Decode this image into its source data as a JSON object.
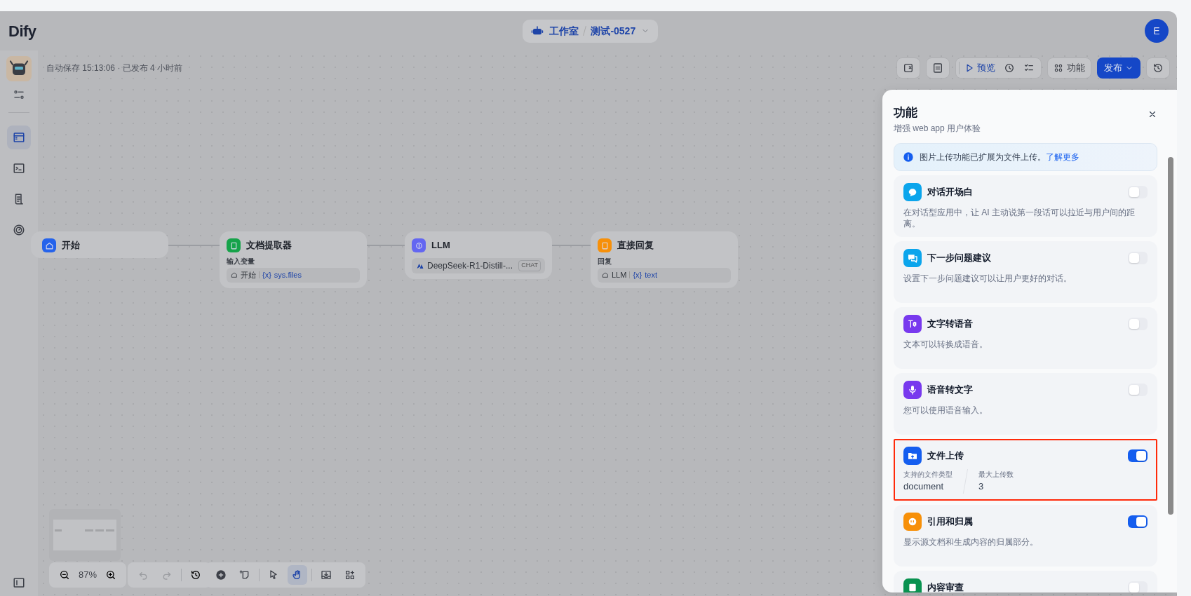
{
  "header": {
    "logo": "Dify",
    "workspace": "工作室",
    "app_name": "测试-0527",
    "avatar": "E"
  },
  "autosave": "自动保存 15:13:06 · 已发布 4 小时前",
  "sidebar": {
    "items": [
      {
        "selected": true
      },
      {
        "selected": false
      },
      {
        "selected": false
      },
      {
        "selected": false
      }
    ]
  },
  "toolbar": {
    "preview": "预览",
    "features": "功能",
    "publish": "发布"
  },
  "nodes": [
    {
      "kind": "start",
      "title": "开始",
      "color": "#2563eb"
    },
    {
      "kind": "vars",
      "title": "文档提取器",
      "color": "#16a34a",
      "label": "输入变量",
      "source": "开始",
      "var_icon": "{x}",
      "variable": "sys.files"
    },
    {
      "kind": "model",
      "title": "LLM",
      "color": "#6366f1",
      "model": "DeepSeek-R1-Distill-...",
      "badge": "CHAT"
    },
    {
      "kind": "vars",
      "title": "直接回复",
      "color": "#f79009",
      "label": "回复",
      "source": "LLM",
      "var_icon": "{x}",
      "variable": "text"
    }
  ],
  "zoom": {
    "level_text": "87%"
  },
  "tools": [
    {
      "selected": false
    },
    {
      "selected": false
    },
    {
      "selected": false
    },
    {
      "selected": true
    },
    {
      "selected": false
    },
    {
      "selected": false
    }
  ],
  "panel": {
    "title": "功能",
    "subtitle": "增强 web app 用户体验",
    "notice": "图片上传功能已扩展为文件上传。",
    "notice_link": "了解更多",
    "features": [
      {
        "kind": "text",
        "color": "#0ba5ec",
        "title": "对话开场白",
        "on": false,
        "highlighted": false,
        "description": "在对话型应用中，让 AI 主动说第一段话可以拉近与用户间的距离。"
      },
      {
        "kind": "text",
        "color": "#0ba5ec",
        "title": "下一步问题建议",
        "on": false,
        "highlighted": false,
        "description": "设置下一步问题建议可以让用户更好的对话。"
      },
      {
        "kind": "text",
        "color": "#7839ee",
        "title": "文字转语音",
        "on": false,
        "highlighted": false,
        "description": "文本可以转换成语音。"
      },
      {
        "kind": "text",
        "color": "#7839ee",
        "title": "语音转文字",
        "on": false,
        "highlighted": false,
        "description": "您可以使用语音输入。"
      },
      {
        "kind": "upload",
        "color": "#155eef",
        "title": "文件上传",
        "on": true,
        "highlighted": true,
        "fields": [
          {
            "label": "支持的文件类型",
            "value": "document"
          },
          {
            "label": "最大上传数",
            "value": "3"
          }
        ]
      },
      {
        "kind": "text",
        "color": "#f79009",
        "title": "引用和归属",
        "on": true,
        "highlighted": false,
        "description": "显示源文档和生成内容的归属部分。"
      },
      {
        "kind": "title",
        "color": "#099250",
        "title": "内容审查",
        "on": false,
        "highlighted": false
      }
    ]
  }
}
